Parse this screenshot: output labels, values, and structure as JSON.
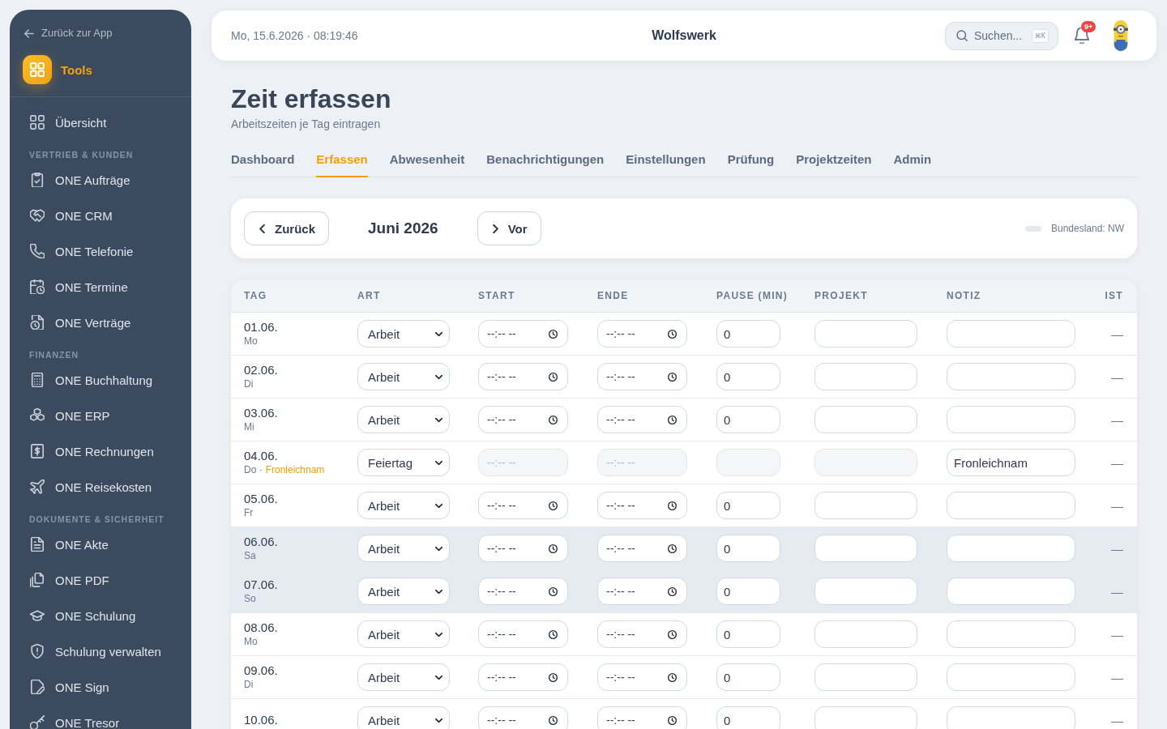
{
  "sidebar": {
    "back_link": "Zurück zur App",
    "brand": "Tools",
    "sections": [
      {
        "items": [
          {
            "label": "Übersicht"
          }
        ]
      },
      {
        "label": "VERTRIEB & KUNDEN",
        "items": [
          {
            "label": "ONE Aufträge"
          },
          {
            "label": "ONE CRM"
          },
          {
            "label": "ONE Telefonie"
          },
          {
            "label": "ONE Termine"
          },
          {
            "label": "ONE Verträge"
          }
        ]
      },
      {
        "label": "FINANZEN",
        "items": [
          {
            "label": "ONE Buchhaltung"
          },
          {
            "label": "ONE ERP"
          },
          {
            "label": "ONE Rechnungen"
          },
          {
            "label": "ONE Reisekosten"
          }
        ]
      },
      {
        "label": "DOKUMENTE & SICHERHEIT",
        "items": [
          {
            "label": "ONE Akte"
          },
          {
            "label": "ONE PDF"
          },
          {
            "label": "ONE Schulung"
          },
          {
            "label": "Schulung verwalten"
          },
          {
            "label": "ONE Sign"
          },
          {
            "label": "ONE Tresor"
          }
        ]
      }
    ]
  },
  "header": {
    "datetime": "Mo, 15.6.2026 · 08:19:46",
    "company": "Wolfswerk",
    "search": {
      "placeholder": "Suchen...",
      "shortcut": "⌘K"
    },
    "notification_badge": "9+"
  },
  "page": {
    "title": "Zeit erfassen",
    "subtitle": "Arbeitszeiten je Tag eintragen"
  },
  "tabs": [
    {
      "label": "Dashboard",
      "selected": false
    },
    {
      "label": "Erfassen",
      "selected": true
    },
    {
      "label": "Abwesenheit",
      "selected": false
    },
    {
      "label": "Benachrichtigungen",
      "selected": false
    },
    {
      "label": "Einstellungen",
      "selected": false
    },
    {
      "label": "Prüfung",
      "selected": false
    },
    {
      "label": "Projektzeiten",
      "selected": false
    },
    {
      "label": "Admin",
      "selected": false
    }
  ],
  "month_nav": {
    "previous": "Zurück",
    "month": "Juni 2026",
    "next": "Vor",
    "region": "Bundesland: NW"
  },
  "table": {
    "columns": [
      "TAG",
      "ART",
      "START",
      "ENDE",
      "PAUSE (MIN)",
      "PROJEKT",
      "NOTIZ",
      "IST"
    ],
    "rows": [
      {
        "date": "01.06.",
        "weekday": "Mo",
        "weekend": false,
        "disabled": false,
        "type": "Arbeit",
        "start_placeholder": "--:-- --",
        "end_placeholder": "--:-- --",
        "pause": "0",
        "ist": "—"
      },
      {
        "date": "02.06.",
        "weekday": "Di",
        "weekend": false,
        "disabled": false,
        "type": "Arbeit",
        "start_placeholder": "--:-- --",
        "end_placeholder": "--:-- --",
        "pause": "0",
        "ist": "—"
      },
      {
        "date": "03.06.",
        "weekday": "Mi",
        "weekend": false,
        "disabled": false,
        "type": "Arbeit",
        "start_placeholder": "--:-- --",
        "end_placeholder": "--:-- --",
        "pause": "0",
        "ist": "—"
      },
      {
        "date": "04.06.",
        "weekday": "Do ·",
        "holiday": "Fronleichnam",
        "weekend": false,
        "disabled": true,
        "type": "Feiertag",
        "start_placeholder": "--:-- --",
        "end_placeholder": "--:-- --",
        "note": "Fronleichnam",
        "ist": "—"
      },
      {
        "date": "05.06.",
        "weekday": "Fr",
        "weekend": false,
        "disabled": false,
        "type": "Arbeit",
        "start_placeholder": "--:-- --",
        "end_placeholder": "--:-- --",
        "pause": "0",
        "ist": "—"
      },
      {
        "date": "06.06.",
        "weekday": "Sa",
        "weekend": true,
        "disabled": false,
        "type": "Arbeit",
        "start_placeholder": "--:-- --",
        "end_placeholder": "--:-- --",
        "pause": "0",
        "ist": "—"
      },
      {
        "date": "07.06.",
        "weekday": "So",
        "weekend": true,
        "disabled": false,
        "type": "Arbeit",
        "start_placeholder": "--:-- --",
        "end_placeholder": "--:-- --",
        "pause": "0",
        "ist": "—"
      },
      {
        "date": "08.06.",
        "weekday": "Mo",
        "weekend": false,
        "disabled": false,
        "type": "Arbeit",
        "start_placeholder": "--:-- --",
        "end_placeholder": "--:-- --",
        "pause": "0",
        "ist": "—"
      },
      {
        "date": "09.06.",
        "weekday": "Di",
        "weekend": false,
        "disabled": false,
        "type": "Arbeit",
        "start_placeholder": "--:-- --",
        "end_placeholder": "--:-- --",
        "pause": "0",
        "ist": "—"
      },
      {
        "date": "10.06.",
        "weekend": false,
        "disabled": false,
        "type": "Arbeit",
        "start_placeholder": "--:-- --",
        "end_placeholder": "--:-- --",
        "pause": "0",
        "ist": "—"
      }
    ]
  }
}
